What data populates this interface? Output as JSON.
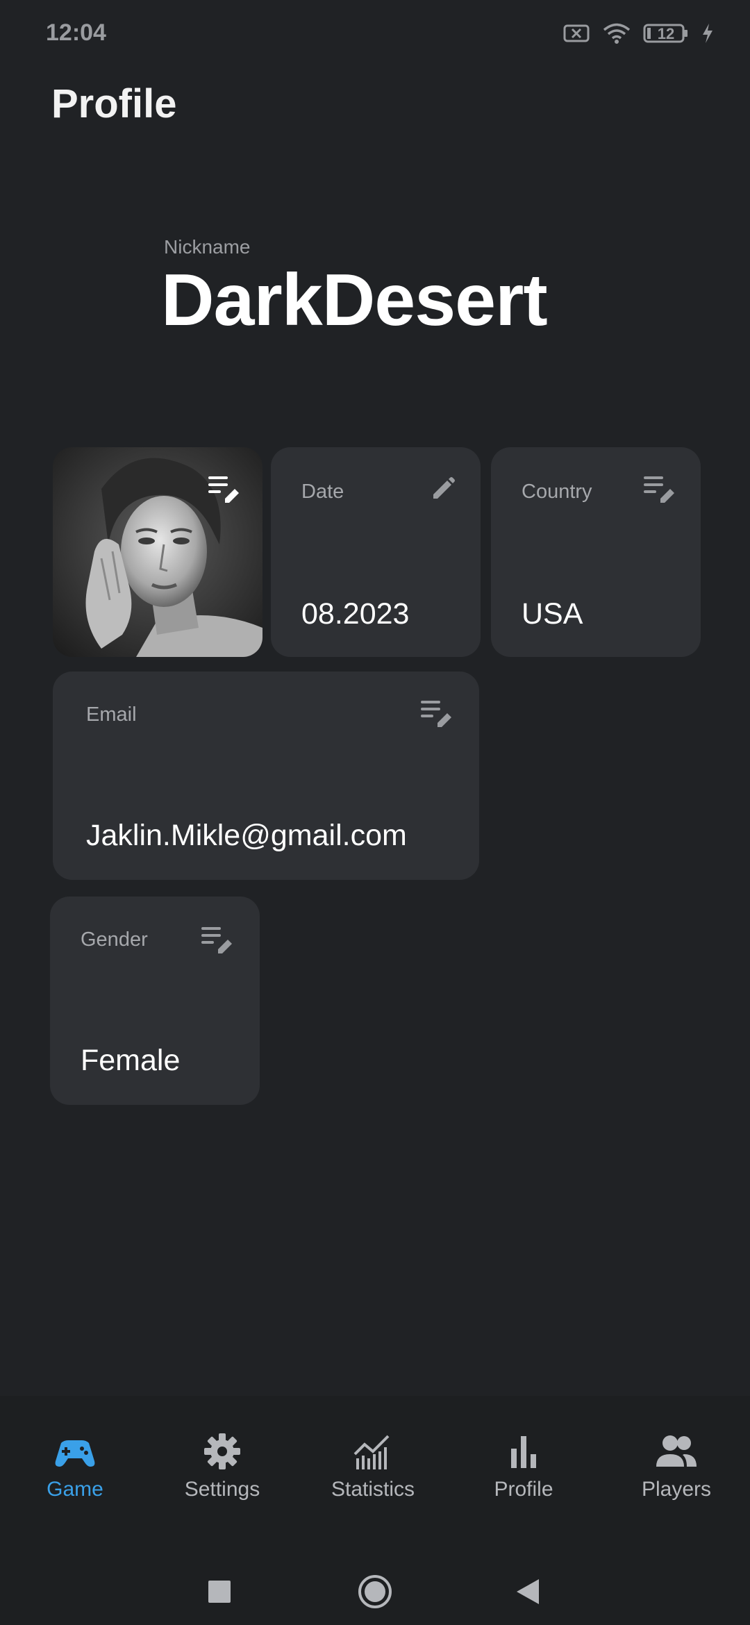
{
  "status_bar": {
    "time": "12:04",
    "battery_level": "12",
    "icons": [
      "no-sim-icon",
      "wifi-icon",
      "battery-icon",
      "charging-icon"
    ]
  },
  "header": {
    "title": "Profile"
  },
  "nickname": {
    "label": "Nickname",
    "value": "DarkDesert"
  },
  "cards": {
    "photo": {
      "icon": "edit-list-icon"
    },
    "date": {
      "label": "Date",
      "value": "08.2023",
      "icon": "pencil-icon"
    },
    "country": {
      "label": "Country",
      "value": "USA",
      "icon": "edit-list-icon"
    },
    "email": {
      "label": "Email",
      "value": "Jaklin.Mikle@gmail.com",
      "icon": "edit-list-icon"
    },
    "gender": {
      "label": "Gender",
      "value": "Female",
      "icon": "edit-list-icon"
    }
  },
  "bottom_nav": {
    "items": [
      {
        "label": "Game",
        "icon": "gamepad-icon",
        "active": true
      },
      {
        "label": "Settings",
        "icon": "gear-icon",
        "active": false
      },
      {
        "label": "Statistics",
        "icon": "line-chart-icon",
        "active": false
      },
      {
        "label": "Profile",
        "icon": "bar-chart-icon",
        "active": false
      },
      {
        "label": "Players",
        "icon": "people-icon",
        "active": false
      }
    ]
  },
  "system_nav": {
    "buttons": [
      "recents-button",
      "home-button",
      "back-button"
    ]
  },
  "colors": {
    "background": "#202225",
    "card": "#2e3034",
    "accent": "#3aa0e8",
    "label": "#a6a8ac"
  }
}
